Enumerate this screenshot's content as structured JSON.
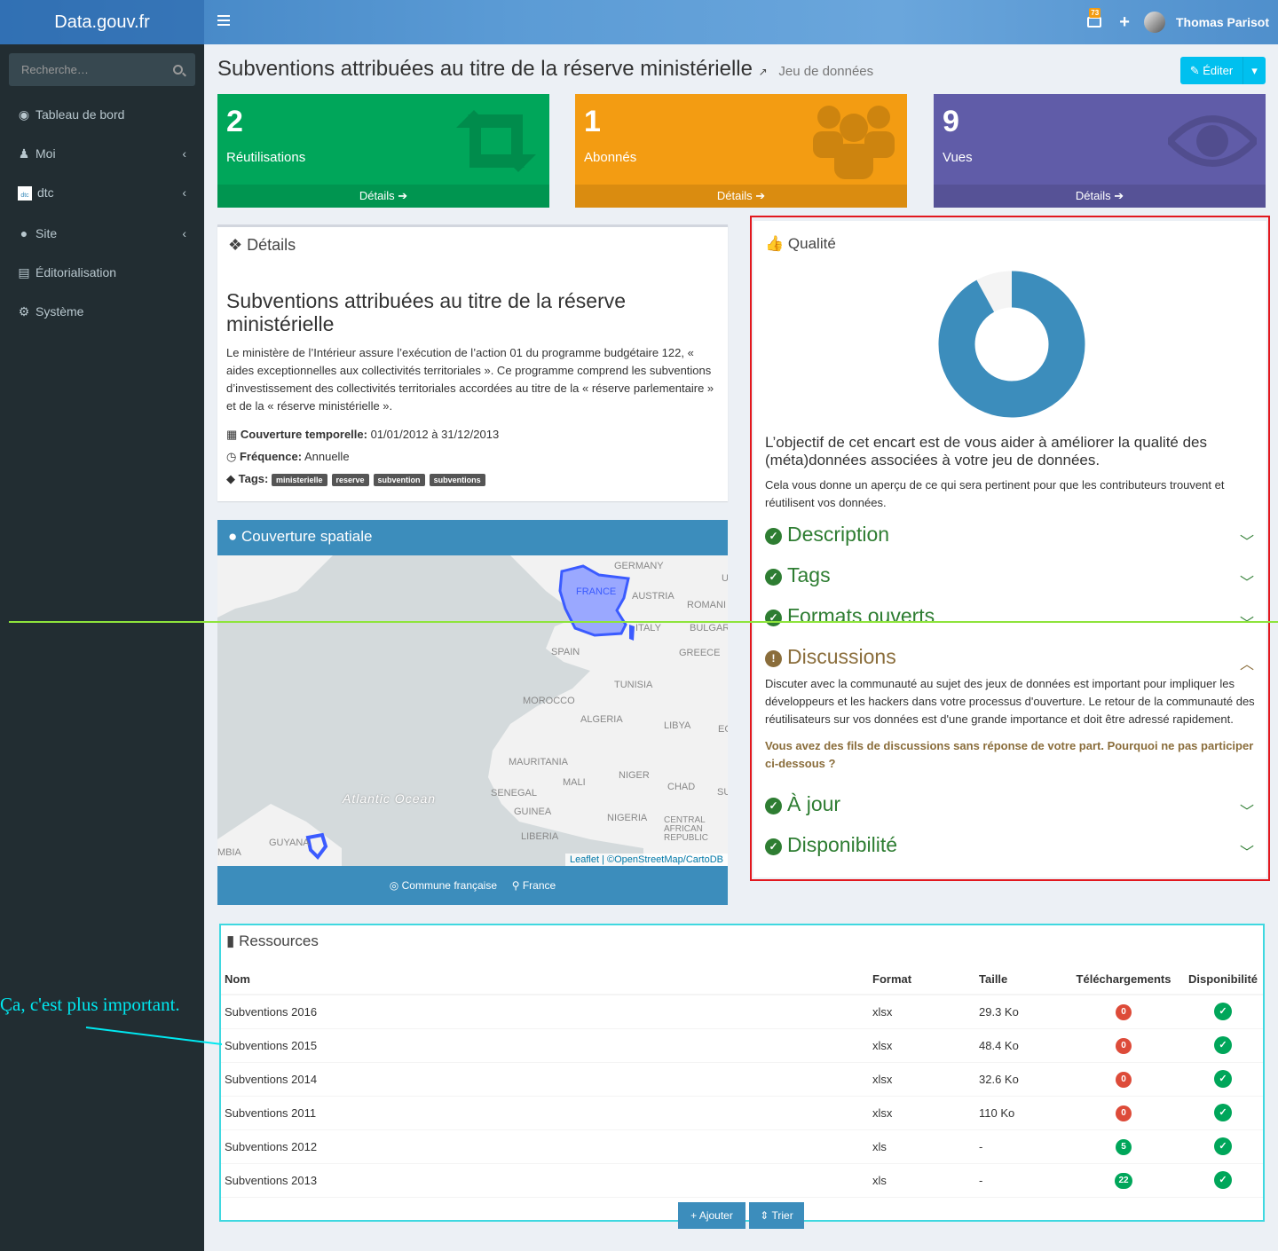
{
  "header": {
    "brand": "Data.gouv.fr",
    "mail_count": "73",
    "user_name": "Thomas Parisot"
  },
  "sidebar": {
    "search_placeholder": "Recherche…",
    "items": [
      {
        "label": "Tableau de bord",
        "icon": "dashboard-icon"
      },
      {
        "label": "Moi",
        "icon": "person-icon"
      },
      {
        "label": "dtc",
        "icon": "dtc-logo"
      },
      {
        "label": "Site",
        "icon": "globe-icon"
      },
      {
        "label": "Éditorialisation",
        "icon": "newspaper-icon"
      },
      {
        "label": "Système",
        "icon": "cogs-icon"
      }
    ]
  },
  "page": {
    "title": "Subventions attribuées au titre de la réserve ministérielle",
    "subtitle": "Jeu de données",
    "edit_label": "Éditer"
  },
  "stats": [
    {
      "value": "2",
      "label": "Réutilisations",
      "footer": "Détails",
      "color": "#00a65a"
    },
    {
      "value": "1",
      "label": "Abonnés",
      "footer": "Détails",
      "color": "#f39c12"
    },
    {
      "value": "9",
      "label": "Vues",
      "footer": "Détails",
      "color": "#605ca8"
    }
  ],
  "details": {
    "box_title": "Détails",
    "heading": "Subventions attribuées au titre de la réserve ministérielle",
    "description": "Le ministère de l’Intérieur assure l’exécution de l’action 01 du programme budgétaire 122, « aides exceptionnelles aux collectivités territoriales ». Ce programme comprend les subventions d’investissement des collectivités territoriales accordées au titre de la « réserve parlementaire » et de la « réserve ministérielle ».",
    "coverage_label": "Couverture temporelle:",
    "coverage_value": "01/01/2012 à 31/12/2013",
    "frequency_label": "Fréquence:",
    "frequency_value": "Annuelle",
    "tags_label": "Tags:",
    "tags": [
      "ministerielle",
      "reserve",
      "subvention",
      "subventions"
    ]
  },
  "spatial": {
    "title": "Couverture spatiale",
    "granularity": "Commune française",
    "zone": "France",
    "attribution": "Leaflet | ©OpenStreetMap/CartoDB",
    "map_labels": [
      "GERMANY",
      "FRANCE",
      "AUSTRIA",
      "ROMANI",
      "ITALY",
      "BULGAR",
      "SPAIN",
      "GREECE",
      "TUNISIA",
      "MOROCCO",
      "ALGERIA",
      "LIBYA",
      "EG",
      "MAURITANIA",
      "MALI",
      "NIGER",
      "CHAD",
      "SU",
      "SENEGAL",
      "GUINEA",
      "NIGERIA",
      "CENTRAL AFRICAN REPUBLIC",
      "LIBERIA",
      "Atlantic Ocean",
      "GUYANA",
      "MBIA",
      "U"
    ]
  },
  "quality": {
    "title": "Qualité",
    "score_fraction": 0.92,
    "intro": "L’objectif de cet encart est de vous aider à améliorer la qualité des (méta)données associées à votre jeu de données.",
    "sub": "Cela vous donne un aperçu de ce qui sera pertinent pour que les contributeurs trouvent et réutilisent vos données.",
    "items": [
      "Description",
      "Tags",
      "Formats ouverts",
      "Discussions",
      "À jour",
      "Disponibilité"
    ],
    "discussions_text": "Discuter avec la communauté au sujet des jeux de données est important pour impliquer les développeurs et les hackers dans votre processus d'ouverture. Le retour de la communauté des réutilisateurs sur vos données est d'une grande importance et doit être adressé rapidement.",
    "discussions_warning": "Vous avez des fils de discussions sans réponse de votre part. Pourquoi ne pas participer ci-dessous ?"
  },
  "resources": {
    "title": "Ressources",
    "columns": [
      "Nom",
      "Format",
      "Taille",
      "Téléchargements",
      "Disponibilité"
    ],
    "rows": [
      {
        "name": "Subventions 2016",
        "format": "xlsx",
        "size": "29.3 Ko",
        "downloads": "0"
      },
      {
        "name": "Subventions 2015",
        "format": "xlsx",
        "size": "48.4 Ko",
        "downloads": "0"
      },
      {
        "name": "Subventions 2014",
        "format": "xlsx",
        "size": "32.6 Ko",
        "downloads": "0"
      },
      {
        "name": "Subventions 2011",
        "format": "xlsx",
        "size": "110 Ko",
        "downloads": "0"
      },
      {
        "name": "Subventions 2012",
        "format": "xls",
        "size": "-",
        "downloads": "5"
      },
      {
        "name": "Subventions 2013",
        "format": "xls",
        "size": "-",
        "downloads": "22"
      }
    ],
    "add_label": "Ajouter",
    "sort_label": "Trier",
    "availability_mark": "✓"
  },
  "annotation": "Ça, c'est plus important."
}
